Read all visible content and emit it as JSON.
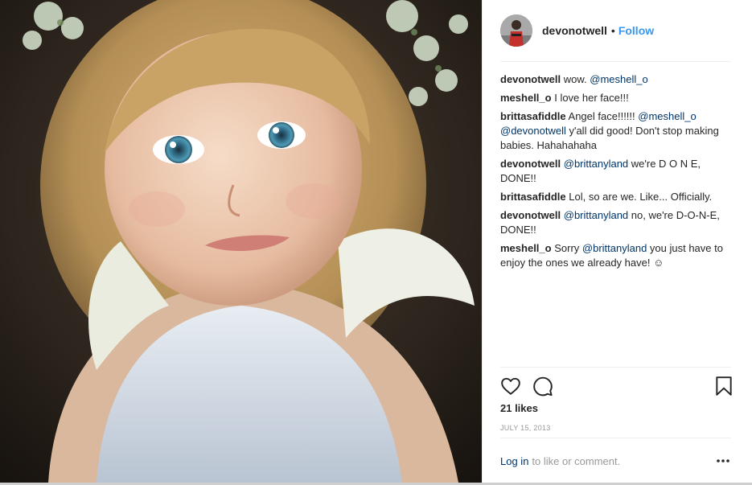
{
  "post": {
    "owner_username": "devonotwell",
    "separator": "•",
    "follow_label": "Follow",
    "photo_icon": "photo-of-child"
  },
  "comments": [
    {
      "user": "devonotwell",
      "parts": [
        {
          "t": "wow. "
        },
        {
          "t": "@meshell_o",
          "m": true
        }
      ]
    },
    {
      "user": "meshell_o",
      "parts": [
        {
          "t": "I love her face!!!"
        }
      ]
    },
    {
      "user": "brittasafiddle",
      "parts": [
        {
          "t": "Angel face!!!!!! "
        },
        {
          "t": "@meshell_o",
          "m": true
        },
        {
          "t": " "
        },
        {
          "t": "@devonotwell",
          "m": true
        },
        {
          "t": " y'all did good! Don't stop making babies. Hahahahaha"
        }
      ]
    },
    {
      "user": "devonotwell",
      "parts": [
        {
          "t": "@brittanyland",
          "m": true
        },
        {
          "t": " we're D O N E, DONE!!"
        }
      ]
    },
    {
      "user": "brittasafiddle",
      "parts": [
        {
          "t": "Lol, so are we. Like... Officially."
        }
      ]
    },
    {
      "user": "devonotwell",
      "parts": [
        {
          "t": "@brittanyland",
          "m": true
        },
        {
          "t": " no, we're D-O-N-E, DONE!!"
        }
      ]
    },
    {
      "user": "meshell_o",
      "parts": [
        {
          "t": "Sorry "
        },
        {
          "t": "@brittanyland",
          "m": true
        },
        {
          "t": " you just have to enjoy the ones we already have! ☺"
        }
      ]
    }
  ],
  "actions": {
    "like_icon": "heart-icon",
    "comment_icon": "comment-bubble-icon",
    "save_icon": "bookmark-icon"
  },
  "likes_text": "21 likes",
  "timestamp": "JULY 15, 2013",
  "footer": {
    "login_label": "Log in",
    "prompt": "to like or comment.",
    "more_icon": "more-options-icon"
  },
  "colors": {
    "link": "#003569",
    "follow": "#3897f0",
    "muted": "#999999",
    "text": "#262626",
    "border": "#efefef"
  }
}
